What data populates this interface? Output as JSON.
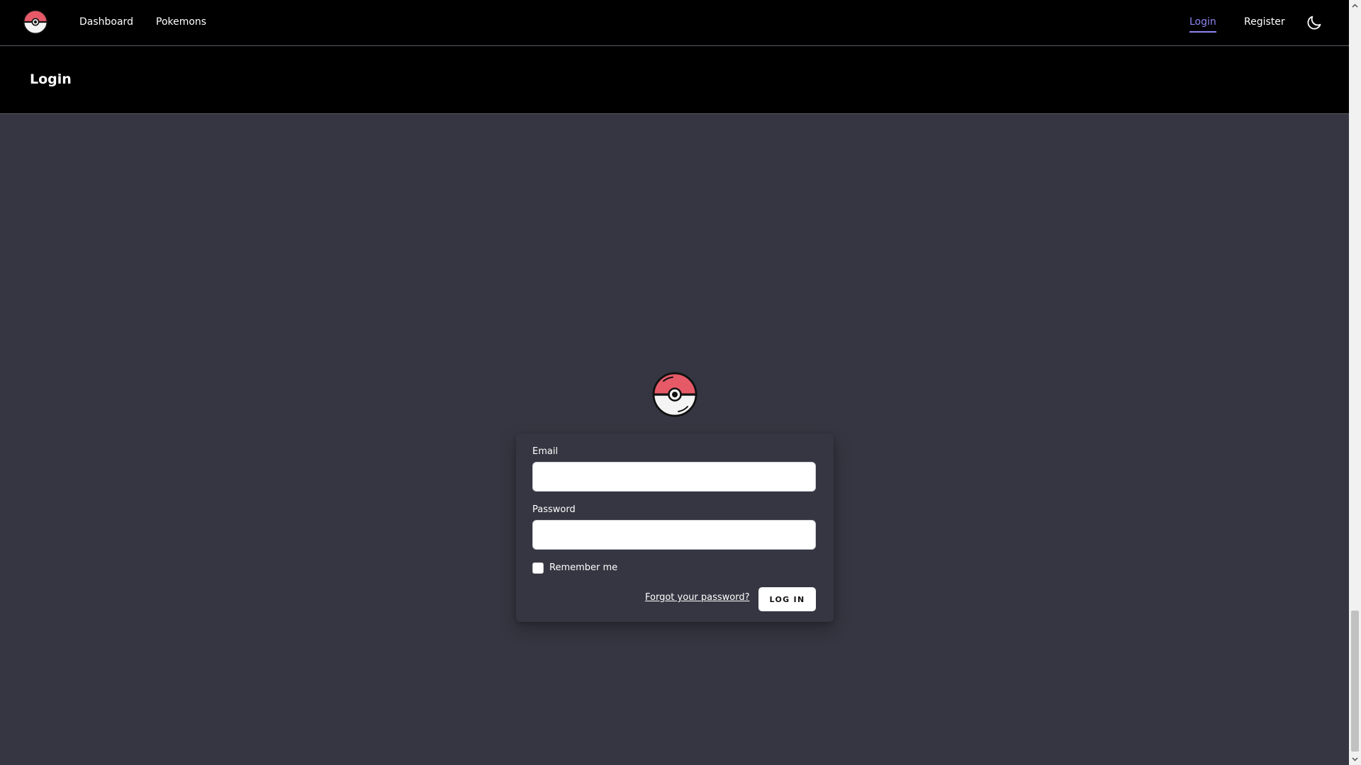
{
  "navbar": {
    "logo_icon": "pokeball-icon",
    "links": [
      {
        "label": "Dashboard"
      },
      {
        "label": "Pokemons"
      }
    ],
    "auth_links": [
      {
        "label": "Login",
        "active": true
      },
      {
        "label": "Register",
        "active": false
      }
    ],
    "theme_icon": "moon-icon"
  },
  "header": {
    "title": "Login"
  },
  "login_card": {
    "logo_icon": "pokeball-icon",
    "email_label": "Email",
    "email_value": "",
    "password_label": "Password",
    "password_value": "",
    "remember_label": "Remember me",
    "remember_checked": false,
    "forgot_password": "Forgot your password?",
    "submit_label": "LOG IN"
  },
  "colors": {
    "nav_background": "#000000",
    "page_background": "#363642",
    "active_link": "#8f86f2",
    "pokeball_red": "#e65a68"
  },
  "scrollbar": {
    "icon_up": "chevron-up-icon",
    "icon_down": "chevron-down-icon"
  }
}
